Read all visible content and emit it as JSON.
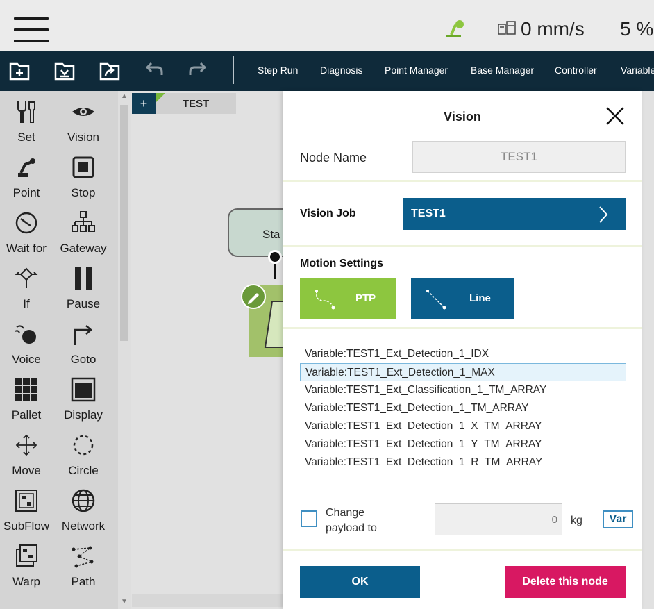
{
  "status": {
    "speed": "0 mm/s",
    "percent": "5 %"
  },
  "toolbar": {
    "items": [
      "Step Run",
      "Diagnosis",
      "Point Manager",
      "Base Manager",
      "Controller",
      "Variable"
    ]
  },
  "palette": {
    "items": [
      {
        "label": "Set",
        "icon": "wrench-icon"
      },
      {
        "label": "Vision",
        "icon": "eye-icon"
      },
      {
        "label": "Point",
        "icon": "robot-arm-icon"
      },
      {
        "label": "Stop",
        "icon": "stop-icon"
      },
      {
        "label": "Wait for",
        "icon": "clock-icon"
      },
      {
        "label": "Gateway",
        "icon": "gateway-icon"
      },
      {
        "label": "If",
        "icon": "if-icon"
      },
      {
        "label": "Pause",
        "icon": "pause-icon"
      },
      {
        "label": "Voice",
        "icon": "voice-icon"
      },
      {
        "label": "Goto",
        "icon": "goto-icon"
      },
      {
        "label": "Pallet",
        "icon": "pallet-icon"
      },
      {
        "label": "Display",
        "icon": "display-icon"
      },
      {
        "label": "Move",
        "icon": "move-icon"
      },
      {
        "label": "Circle",
        "icon": "circle-icon"
      },
      {
        "label": "SubFlow",
        "icon": "subflow-icon"
      },
      {
        "label": "Network",
        "icon": "globe-icon"
      },
      {
        "label": "Warp",
        "icon": "warp-icon"
      },
      {
        "label": "Path",
        "icon": "path-icon"
      }
    ]
  },
  "canvas": {
    "tab_label": "TEST",
    "tab_add": "+",
    "start_label": "Sta"
  },
  "dialog": {
    "title": "Vision",
    "node_name_label": "Node Name",
    "node_name_value": "TEST1",
    "vision_job_label": "Vision Job",
    "vision_job_value": "TEST1",
    "motion_settings_label": "Motion Settings",
    "ptp_label": "PTP",
    "line_label": "Line",
    "variables": [
      "Variable:TEST1_Ext_Detection_1_IDX",
      "Variable:TEST1_Ext_Detection_1_MAX",
      "Variable:TEST1_Ext_Classification_1_TM_ARRAY",
      "Variable:TEST1_Ext_Detection_1_TM_ARRAY",
      "Variable:TEST1_Ext_Detection_1_X_TM_ARRAY",
      "Variable:TEST1_Ext_Detection_1_Y_TM_ARRAY",
      "Variable:TEST1_Ext_Detection_1_R_TM_ARRAY"
    ],
    "selected_variable_index": 1,
    "change_payload_label": "Change payload to",
    "payload_value": "0",
    "payload_unit": "kg",
    "var_button": "Var",
    "ok_button": "OK",
    "delete_button": "Delete this node"
  },
  "colors": {
    "toolbar_bg": "#0f2a3a",
    "primary": "#0b5e8c",
    "green": "#8dc63f",
    "danger": "#d81862"
  }
}
